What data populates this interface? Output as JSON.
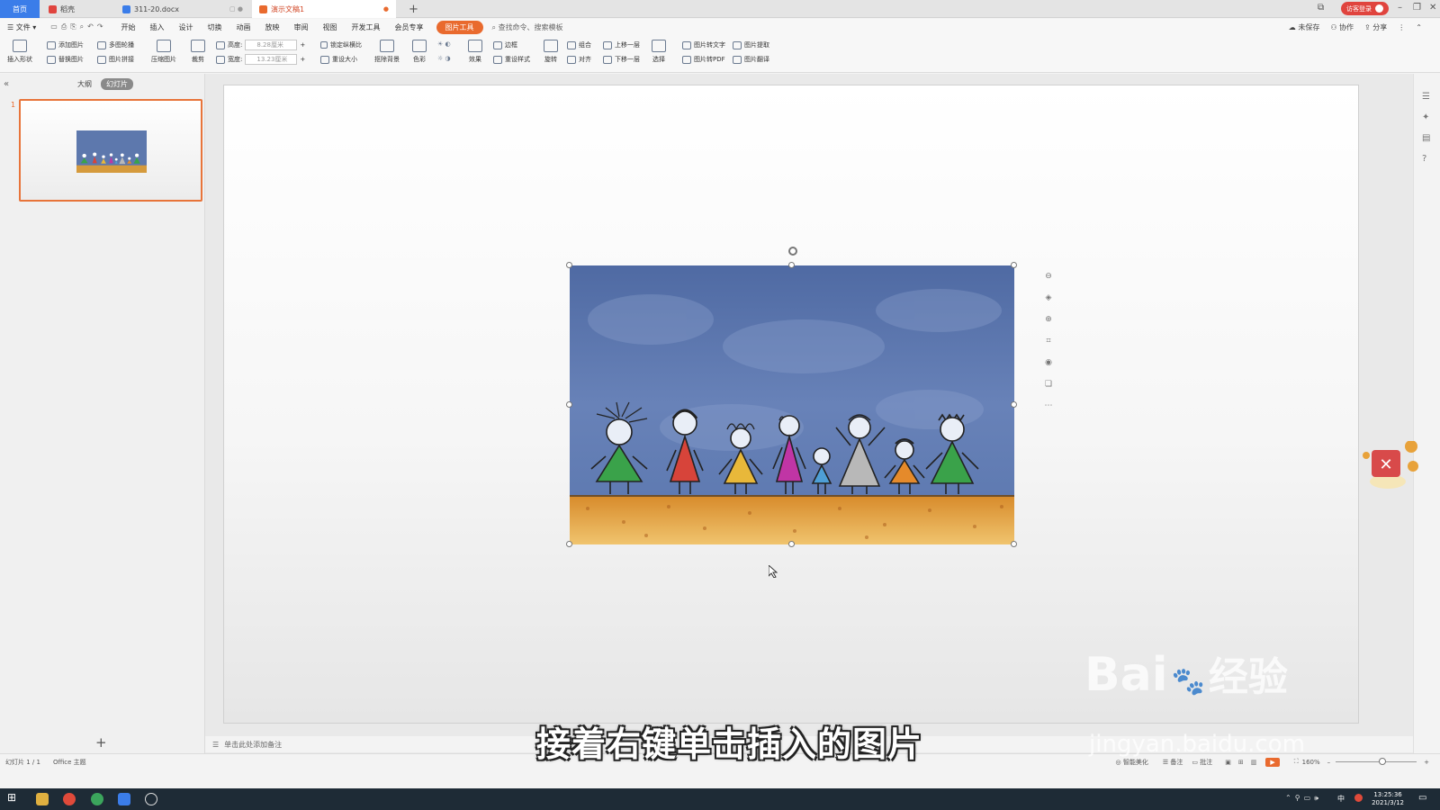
{
  "titlebar": {
    "tabs": [
      {
        "label": "首页",
        "color": "#3b7de9"
      },
      {
        "label": "稻壳",
        "color": "#e0443e"
      },
      {
        "label": "311-20.docx",
        "color": "#3b7de9"
      },
      {
        "label": "演示文稿1",
        "color": "#e96a2e"
      }
    ],
    "login_label": "访客登录"
  },
  "menubar": {
    "file": "文件",
    "items": [
      "开始",
      "插入",
      "设计",
      "切换",
      "动画",
      "放映",
      "审阅",
      "视图",
      "开发工具",
      "会员专享"
    ],
    "active_tool": "图片工具",
    "search_placeholder": "查找命令、搜索模板",
    "right": [
      "未保存",
      "协作",
      "分享"
    ]
  },
  "ribbon": {
    "insert_shape": "插入形状",
    "add_picture": "添加图片",
    "multi_outline": "多图轮播",
    "replace_picture": "替换图片",
    "picture_stitch": "图片拼接",
    "compress": "压缩图片",
    "crop": "裁剪",
    "height_label": "高度:",
    "height_value": "8.28厘米",
    "width_label": "宽度:",
    "width_value": "13.23厘米",
    "lock_ratio": "锁定纵横比",
    "reset_size": "重设大小",
    "cutout": "抠除背景",
    "color": "色彩",
    "effect": "效果",
    "border": "边框",
    "reset_style": "重设样式",
    "rotate": "旋转",
    "group": "组合",
    "align": "对齐",
    "bring_forward": "上移一层",
    "send_backward": "下移一层",
    "select": "选择",
    "pic_to_text": "图片转文字",
    "pic_extract": "图片提取",
    "pic_to_pdf": "图片转PDF",
    "pic_translate": "图片翻译"
  },
  "leftpanel": {
    "outline_tab": "大纲",
    "slides_tab": "幻灯片",
    "slide_number": "1"
  },
  "notes_placeholder": "单击此处添加备注",
  "statusbar": {
    "slide_info": "幻灯片 1 / 1",
    "theme": "Office 主题",
    "smart": "智能美化",
    "notes": "备注",
    "comments": "批注",
    "zoom": "160%"
  },
  "taskbar": {
    "time": "13:25:36",
    "date": "2021/3/12",
    "ime": "中"
  },
  "subtitle": "接着右键单击插入的图片",
  "watermark": {
    "logo": "Bai",
    "logo_cn": "经验",
    "url": "jingyan.baidu.com"
  }
}
